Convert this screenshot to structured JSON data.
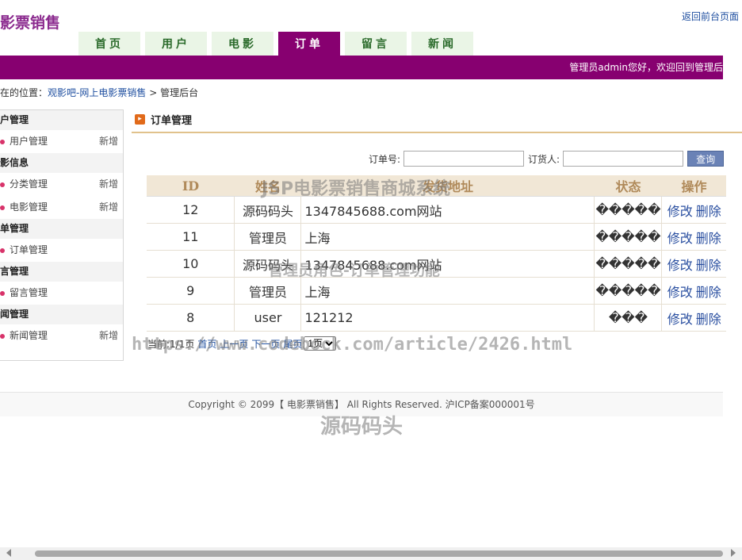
{
  "header": {
    "logo": "影票销售",
    "top_link": "返回前台页面",
    "welcome": "管理员admin您好，欢迎回到管理后"
  },
  "nav": {
    "tabs": [
      {
        "label": "首页",
        "active": false
      },
      {
        "label": "用户",
        "active": false
      },
      {
        "label": "电影",
        "active": false
      },
      {
        "label": "订单",
        "active": true
      },
      {
        "label": "留言",
        "active": false
      },
      {
        "label": "新闻",
        "active": false
      }
    ]
  },
  "breadcrumb": {
    "prefix": "在的位置：",
    "site": "观影吧-网上电影票销售",
    "sep": ">",
    "current": "管理后台"
  },
  "sidebar": {
    "groups": [
      {
        "title": "户管理",
        "items": [
          {
            "label": "用户管理",
            "action": "新增"
          }
        ]
      },
      {
        "title": "影信息",
        "items": [
          {
            "label": "分类管理",
            "action": "新增"
          },
          {
            "label": "电影管理",
            "action": "新增"
          }
        ]
      },
      {
        "title": "单管理",
        "items": [
          {
            "label": "订单管理",
            "action": ""
          }
        ]
      },
      {
        "title": "言管理",
        "items": [
          {
            "label": "留言管理",
            "action": ""
          }
        ]
      },
      {
        "title": "闻管理",
        "items": [
          {
            "label": "新闻管理",
            "action": "新增"
          }
        ]
      }
    ]
  },
  "panel": {
    "title": "订单管理"
  },
  "search": {
    "order_no_label": "订单号:",
    "order_no_value": "",
    "buyer_label": "订货人:",
    "buyer_value": "",
    "button": "查询"
  },
  "table": {
    "headers": [
      "ID",
      "姓名",
      "发货地址",
      "状态",
      "操作"
    ],
    "rows": [
      {
        "id": "12",
        "name": "源码码头",
        "address": "1347845688.com网站",
        "status": "�����",
        "edit": "修改",
        "delete": "删除"
      },
      {
        "id": "11",
        "name": "管理员",
        "address": "上海",
        "status": "�����",
        "edit": "修改",
        "delete": "删除"
      },
      {
        "id": "10",
        "name": "源码码头",
        "address": "1347845688.com网站",
        "status": "�����",
        "edit": "修改",
        "delete": "删除"
      },
      {
        "id": "9",
        "name": "管理员",
        "address": "上海",
        "status": "�����",
        "edit": "修改",
        "delete": "删除"
      },
      {
        "id": "8",
        "name": "user",
        "address": "121212",
        "status": "���",
        "edit": "修改",
        "delete": "删除"
      }
    ]
  },
  "pager": {
    "info": "当前:1/1页",
    "first": "首页",
    "prev": "上一页",
    "next": "下一页",
    "last": "尾页",
    "select": "1页"
  },
  "footer": {
    "text": "Copyright © 2099【 电影票销售】 All Rights Reserved. 沪ICP备案000001号"
  },
  "watermarks": {
    "w1": "JSP电影票销售商城系统",
    "w2": "管理员角色-订单管理功能",
    "w3": "https://www.codebock.com/article/2426.html",
    "w4": "源码码头"
  },
  "colors": {
    "accent": "#870070",
    "link": "#1f4fa0",
    "header_bg": "#f1e7d6"
  }
}
